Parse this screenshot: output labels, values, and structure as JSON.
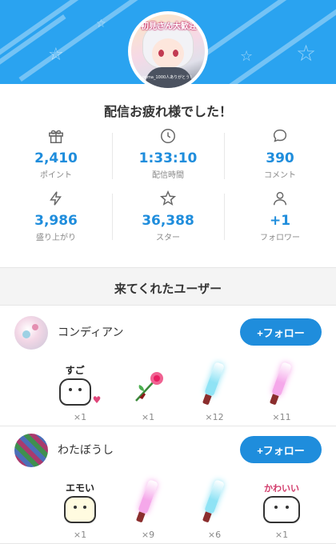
{
  "header": {
    "avatar_title": "初見さん大歓迎",
    "avatar_sub": "onma_1000人ありがとう！"
  },
  "title": "配信お疲れ様でした！",
  "stats": [
    {
      "icon": "gift-icon",
      "value": "2,410",
      "label": "ポイント"
    },
    {
      "icon": "clock-icon",
      "value": "1:33:10",
      "label": "配信時間"
    },
    {
      "icon": "comment-icon",
      "value": "390",
      "label": "コメント"
    },
    {
      "icon": "lightning-icon",
      "value": "3,986",
      "label": "盛り上がり"
    },
    {
      "icon": "star-icon",
      "value": "36,388",
      "label": "スター"
    },
    {
      "icon": "person-icon",
      "value": "+1",
      "label": "フォロワー"
    }
  ],
  "section_title": "来てくれたユーザー",
  "users": [
    {
      "name": "コンディアン",
      "follow_label": "+フォロー",
      "gifts": [
        {
          "kind": "sugoi-stamp",
          "text": "すご",
          "count": "×1"
        },
        {
          "kind": "rose",
          "count": "×1"
        },
        {
          "kind": "penlight-blue",
          "count": "×12"
        },
        {
          "kind": "penlight-pink",
          "count": "×11"
        }
      ]
    },
    {
      "name": "わたぼうし",
      "follow_label": "+フォロー",
      "gifts": [
        {
          "kind": "emoi-stamp",
          "text": "エモい",
          "count": "×1"
        },
        {
          "kind": "penlight-pink",
          "count": "×9"
        },
        {
          "kind": "penlight-blue",
          "count": "×6"
        },
        {
          "kind": "kawaii-stamp",
          "text": "かわいい",
          "count": "×1"
        }
      ]
    }
  ],
  "colors": {
    "accent": "#1f8ddc",
    "header": "#2aa3f0",
    "penlight_blue": "#8fe3f5",
    "penlight_pink": "#f5a8ea"
  }
}
